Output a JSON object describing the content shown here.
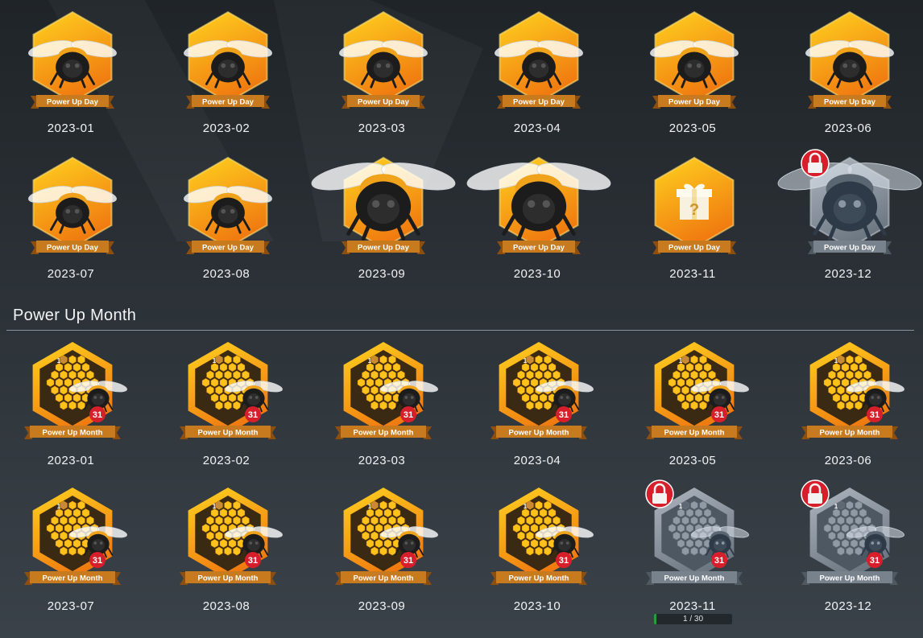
{
  "day_badges": [
    {
      "label": "Power Up Day",
      "date": "2023-01",
      "state": "earned",
      "bee": "small"
    },
    {
      "label": "Power Up Day",
      "date": "2023-02",
      "state": "earned",
      "bee": "small"
    },
    {
      "label": "Power Up Day",
      "date": "2023-03",
      "state": "earned",
      "bee": "small"
    },
    {
      "label": "Power Up Day",
      "date": "2023-04",
      "state": "earned",
      "bee": "small"
    },
    {
      "label": "Power Up Day",
      "date": "2023-05",
      "state": "earned",
      "bee": "small"
    },
    {
      "label": "Power Up Day",
      "date": "2023-06",
      "state": "earned",
      "bee": "small"
    },
    {
      "label": "Power Up Day",
      "date": "2023-07",
      "state": "earned",
      "bee": "small"
    },
    {
      "label": "Power Up Day",
      "date": "2023-08",
      "state": "earned",
      "bee": "small"
    },
    {
      "label": "Power Up Day",
      "date": "2023-09",
      "state": "earned",
      "bee": "large"
    },
    {
      "label": "Power Up Day",
      "date": "2023-10",
      "state": "earned",
      "bee": "large"
    },
    {
      "label": "Power Up Day",
      "date": "2023-11",
      "state": "mystery",
      "bee": "gift"
    },
    {
      "label": "Power Up Day",
      "date": "2023-12",
      "state": "locked",
      "bee": "large"
    }
  ],
  "month_section": {
    "title": "Power Up Month"
  },
  "month_badges": [
    {
      "label": "Power Up Month",
      "date": "2023-01",
      "state": "earned",
      "num_top": "1",
      "num_bottom": "31"
    },
    {
      "label": "Power Up Month",
      "date": "2023-02",
      "state": "earned",
      "num_top": "1",
      "num_bottom": "31"
    },
    {
      "label": "Power Up Month",
      "date": "2023-03",
      "state": "earned",
      "num_top": "1",
      "num_bottom": "31"
    },
    {
      "label": "Power Up Month",
      "date": "2023-04",
      "state": "earned",
      "num_top": "1",
      "num_bottom": "31"
    },
    {
      "label": "Power Up Month",
      "date": "2023-05",
      "state": "earned",
      "num_top": "1",
      "num_bottom": "31"
    },
    {
      "label": "Power Up Month",
      "date": "2023-06",
      "state": "earned",
      "num_top": "1",
      "num_bottom": "31"
    },
    {
      "label": "Power Up Month",
      "date": "2023-07",
      "state": "earned",
      "num_top": "1",
      "num_bottom": "31"
    },
    {
      "label": "Power Up Month",
      "date": "2023-08",
      "state": "earned",
      "num_top": "1",
      "num_bottom": "31"
    },
    {
      "label": "Power Up Month",
      "date": "2023-09",
      "state": "earned",
      "num_top": "1",
      "num_bottom": "31"
    },
    {
      "label": "Power Up Month",
      "date": "2023-10",
      "state": "earned",
      "num_top": "1",
      "num_bottom": "31"
    },
    {
      "label": "Power Up Month",
      "date": "2023-11",
      "state": "locked",
      "num_top": "1",
      "num_bottom": "31"
    },
    {
      "label": "Power Up Month",
      "date": "2023-12",
      "state": "locked",
      "num_top": "1",
      "num_bottom": "31"
    }
  ],
  "progress": {
    "text": "1 / 30",
    "value": 1,
    "max": 30
  },
  "colors": {
    "gold_light": "#ffd21f",
    "gold_dark": "#f07a10",
    "ribbon": "#c77a1e",
    "locked_light": "#aeb7c0",
    "locked_dark": "#6d7782",
    "ribbon_locked": "#77828d",
    "lock_red": "#d71f2b",
    "progress_green": "#2a9d3a"
  }
}
